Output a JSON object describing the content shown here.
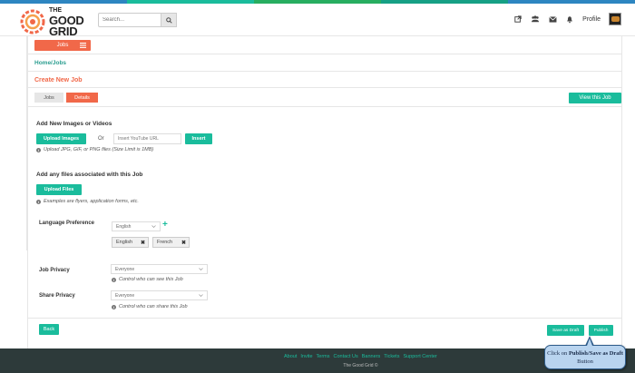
{
  "brand": {
    "line1": "THE",
    "line2": "GOOD",
    "line3": "GRID"
  },
  "header": {
    "search_placeholder": "Search...",
    "profile_label": "Profile",
    "icons": [
      "external-link-icon",
      "users-icon",
      "envelope-icon",
      "bell-icon"
    ]
  },
  "subnav": {
    "jobs_dropdown": "Jobs"
  },
  "breadcrumb": "Home/Jobs",
  "page_title": "Create New Job",
  "tabs": [
    {
      "label": "Jobs",
      "active": false
    },
    {
      "label": "Details",
      "active": true
    }
  ],
  "view_job_label": "View this Job",
  "media": {
    "heading": "Add New Images or Videos",
    "upload_images_label": "Upload Images",
    "or_label": "Or",
    "youtube_placeholder": "Insert YouTube URL",
    "insert_label": "Insert",
    "hint": "Upload JPG, GIF, or PNG files  (Size Limit is 1MB)"
  },
  "files": {
    "heading": "Add any files associated with this Job",
    "upload_label": "Upload Files",
    "hint": "Examples are flyers, application forms, etc."
  },
  "language": {
    "label": "Language Preference",
    "selected": "English",
    "tags": [
      "English",
      "French"
    ]
  },
  "job_privacy": {
    "label": "Job Privacy",
    "selected": "Everyone",
    "hint": "Control who can see this Job"
  },
  "share_privacy": {
    "label": "Share Privacy",
    "selected": "Everyone",
    "hint": "Control who can share this Job"
  },
  "actions": {
    "back_label": "Back",
    "save_draft_label": "Save as Draft",
    "publish_label": "Publish"
  },
  "footer": {
    "links": [
      "About",
      "Invite",
      "Terms",
      "Contact Us",
      "Banners",
      "Tickets",
      "Support Center"
    ],
    "copyright": "The Good Grid ©"
  },
  "callout": {
    "prefix": "Click on ",
    "bold1": "Publish/Save as Draft",
    "suffix": " Button"
  },
  "colors": {
    "accent_orange": "#f16849",
    "accent_teal": "#1abc9c",
    "footer_bg": "#2d3a3a"
  }
}
